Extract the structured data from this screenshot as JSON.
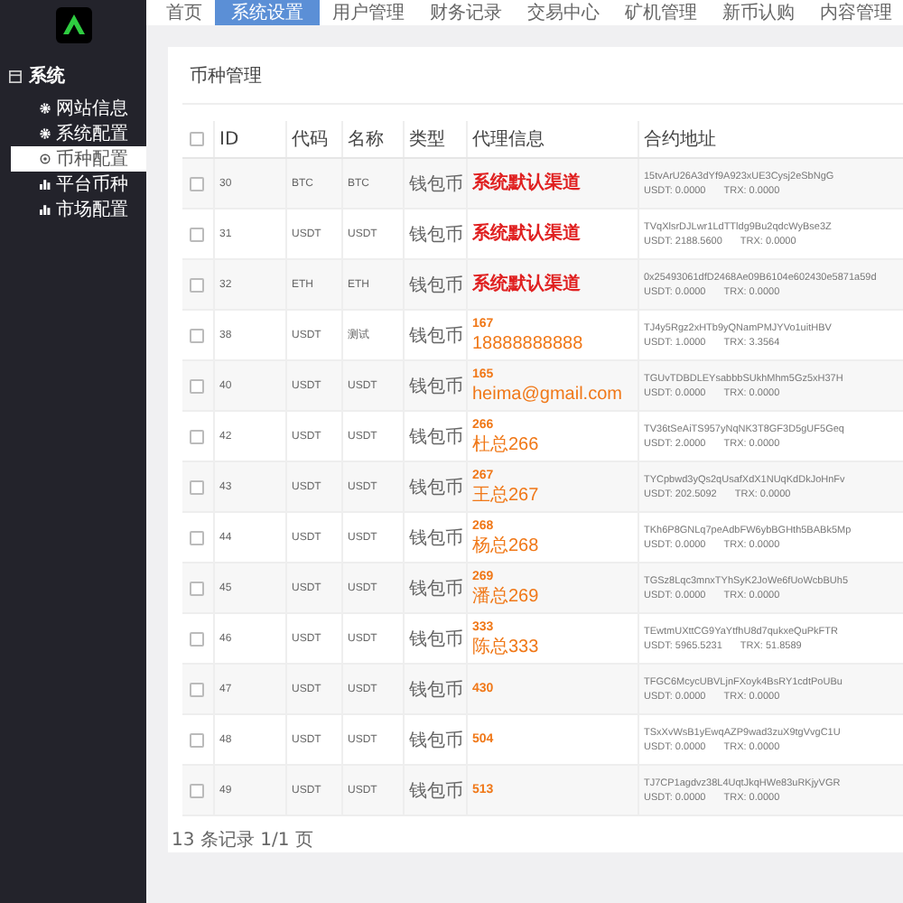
{
  "sidebar": {
    "group": "系统",
    "items": [
      {
        "label": "网站信息",
        "kind": "gear",
        "selected": false
      },
      {
        "label": "系统配置",
        "kind": "gear",
        "selected": false
      },
      {
        "label": "币种配置",
        "kind": "cog",
        "selected": true
      },
      {
        "label": "平台币种",
        "kind": "chart",
        "selected": false
      },
      {
        "label": "市场配置",
        "kind": "chart",
        "selected": false
      }
    ]
  },
  "nav": [
    {
      "label": "首页",
      "selected": false
    },
    {
      "label": "系统设置",
      "selected": true
    },
    {
      "label": "用户管理",
      "selected": false
    },
    {
      "label": "财务记录",
      "selected": false
    },
    {
      "label": "交易中心",
      "selected": false
    },
    {
      "label": "矿机管理",
      "selected": false
    },
    {
      "label": "新币认购",
      "selected": false
    },
    {
      "label": "内容管理",
      "selected": false
    }
  ],
  "card_title": "币种管理",
  "table": {
    "all_checked": false,
    "columns": [
      "ID",
      "代码",
      "名称",
      "类型",
      "代理信息",
      "合约地址"
    ],
    "rows": [
      {
        "checked": false,
        "id": "30",
        "code": "BTC",
        "name": "BTC",
        "type": "钱包币",
        "agent": {
          "kind": "default",
          "lines": [
            "系统默认渠道"
          ]
        },
        "address": "15tvArU26A3dYf9A923xUE3Cysj2eSbNgG",
        "usdt": "USDT:  0.0000",
        "trx": "TRX:  0.0000"
      },
      {
        "checked": false,
        "id": "31",
        "code": "USDT",
        "name": "USDT",
        "type": "钱包币",
        "agent": {
          "kind": "default",
          "lines": [
            "系统默认渠道"
          ]
        },
        "address": "TVqXlsrDJLwr1LdTTldg9Bu2qdcWyBse3Z",
        "usdt": "USDT:  2188.5600",
        "trx": "TRX:  0.0000"
      },
      {
        "checked": false,
        "id": "32",
        "code": "ETH",
        "name": "ETH",
        "type": "钱包币",
        "agent": {
          "kind": "default",
          "lines": [
            "系统默认渠道"
          ]
        },
        "address": "0x25493061dfD2468Ae09B6104e602430e5871a59d",
        "usdt": "USDT:  0.0000",
        "trx": "TRX:  0.0000"
      },
      {
        "checked": false,
        "id": "38",
        "code": "USDT",
        "name": "测试",
        "type": "钱包币",
        "agent": {
          "kind": "agent",
          "lines": [
            "167",
            "18888888888"
          ]
        },
        "address": "TJ4y5Rgz2xHTb9yQNamPMJYVo1uitHBV",
        "usdt": "USDT:  1.0000",
        "trx": "TRX:  3.3564"
      },
      {
        "checked": false,
        "id": "40",
        "code": "USDT",
        "name": "USDT",
        "type": "钱包币",
        "agent": {
          "kind": "agent",
          "lines": [
            "165",
            "heima@gmail.com"
          ]
        },
        "address": "TGUvTDBDLEYsabbbSUkhMhm5Gz5xH37H",
        "usdt": "USDT:  0.0000",
        "trx": "TRX:  0.0000"
      },
      {
        "checked": false,
        "id": "42",
        "code": "USDT",
        "name": "USDT",
        "type": "钱包币",
        "agent": {
          "kind": "agent",
          "lines": [
            "266",
            "杜总266"
          ]
        },
        "address": "TV36tSeAiTS957yNqNK3T8GF3D5gUF5Geq",
        "usdt": "USDT:  2.0000",
        "trx": "TRX:  0.0000"
      },
      {
        "checked": false,
        "id": "43",
        "code": "USDT",
        "name": "USDT",
        "type": "钱包币",
        "agent": {
          "kind": "agent",
          "lines": [
            "267",
            "王总267"
          ]
        },
        "address": "TYCpbwd3yQs2qUsafXdX1NUqKdDkJoHnFv",
        "usdt": "USDT:  202.5092",
        "trx": "TRX:  0.0000"
      },
      {
        "checked": false,
        "id": "44",
        "code": "USDT",
        "name": "USDT",
        "type": "钱包币",
        "agent": {
          "kind": "agent",
          "lines": [
            "268",
            "杨总268"
          ]
        },
        "address": "TKh6P8GNLq7peAdbFW6ybBGHth5BABk5Mp",
        "usdt": "USDT:  0.0000",
        "trx": "TRX:  0.0000"
      },
      {
        "checked": false,
        "id": "45",
        "code": "USDT",
        "name": "USDT",
        "type": "钱包币",
        "agent": {
          "kind": "agent",
          "lines": [
            "269",
            "潘总269"
          ]
        },
        "address": "TGSz8Lqc3mnxTYhSyK2JoWe6fUoWcbBUh5",
        "usdt": "USDT:  0.0000",
        "trx": "TRX:  0.0000"
      },
      {
        "checked": false,
        "id": "46",
        "code": "USDT",
        "name": "USDT",
        "type": "钱包币",
        "agent": {
          "kind": "agent",
          "lines": [
            "333",
            "陈总333"
          ]
        },
        "address": "TEwtmUXttCG9YaYtfhU8d7qukxeQuPkFTR",
        "usdt": "USDT:  5965.5231",
        "trx": "TRX:  51.8589"
      },
      {
        "checked": false,
        "id": "47",
        "code": "USDT",
        "name": "USDT",
        "type": "钱包币",
        "agent": {
          "kind": "agent",
          "lines": [
            "430"
          ]
        },
        "address": "TFGC6McycUBVLjnFXoyk4BsRY1cdtPoUBu",
        "usdt": "USDT:  0.0000",
        "trx": "TRX:  0.0000"
      },
      {
        "checked": false,
        "id": "48",
        "code": "USDT",
        "name": "USDT",
        "type": "钱包币",
        "agent": {
          "kind": "agent",
          "lines": [
            "504"
          ]
        },
        "address": "TSxXvWsB1yEwqAZP9wad3zuX9tgVvgC1U",
        "usdt": "USDT:  0.0000",
        "trx": "TRX:  0.0000"
      },
      {
        "checked": false,
        "id": "49",
        "code": "USDT",
        "name": "USDT",
        "type": "钱包币",
        "agent": {
          "kind": "agent",
          "lines": [
            "513"
          ]
        },
        "address": "TJ7CP1agdvz38L4UqtJkqHWe83uRKjyVGR",
        "usdt": "USDT:  0.0000",
        "trx": "TRX:  0.0000"
      }
    ]
  },
  "footer": "13 条记录 1/1 页"
}
